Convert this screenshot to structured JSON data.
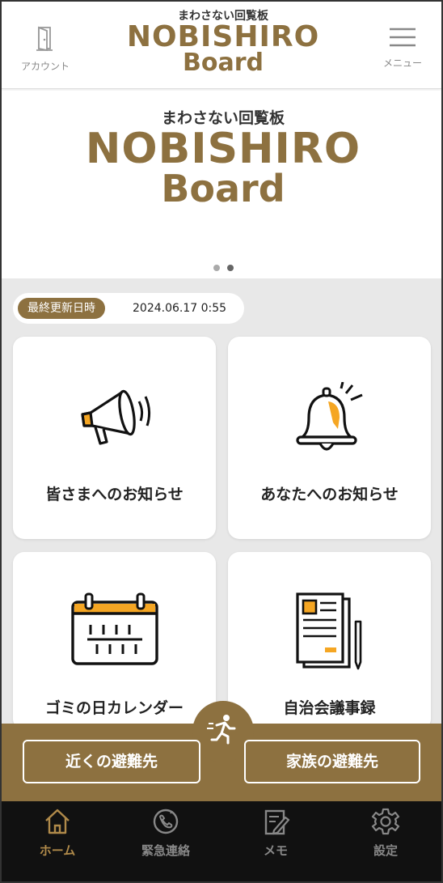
{
  "header": {
    "account_label": "アカウント",
    "menu_label": "メニュー",
    "logo_sub": "まわさない回覧板",
    "logo_main": "NOBISHIRO",
    "logo_board": "Board"
  },
  "banner": {
    "logo_sub": "まわさない回覧板",
    "logo_main": "NOBISHIRO",
    "logo_board": "Board",
    "slide_count": 2,
    "active_slide": 2
  },
  "updated": {
    "label": "最終更新日時",
    "value": "2024.06.17 0:55"
  },
  "cards": [
    {
      "label": "皆さまへのお知らせ",
      "icon": "megaphone-icon"
    },
    {
      "label": "あなたへのお知らせ",
      "icon": "bell-icon"
    },
    {
      "label": "ゴミの日カレンダー",
      "icon": "calendar-icon"
    },
    {
      "label": "自治会議事録",
      "icon": "document-icon"
    }
  ],
  "evacuation": {
    "icon": "running-person-icon",
    "nearby_label": "近くの避難先",
    "family_label": "家族の避難先"
  },
  "nav": [
    {
      "label": "ホーム",
      "icon": "home-icon",
      "active": true
    },
    {
      "label": "緊急連絡",
      "icon": "emergency-phone-icon",
      "active": false
    },
    {
      "label": "メモ",
      "icon": "memo-icon",
      "active": false
    },
    {
      "label": "設定",
      "icon": "gear-icon",
      "active": false
    }
  ],
  "colors": {
    "brand": "#8d7140",
    "accent": "#f5a623",
    "nav_bg": "#111111",
    "nav_active": "#b08a4a"
  }
}
